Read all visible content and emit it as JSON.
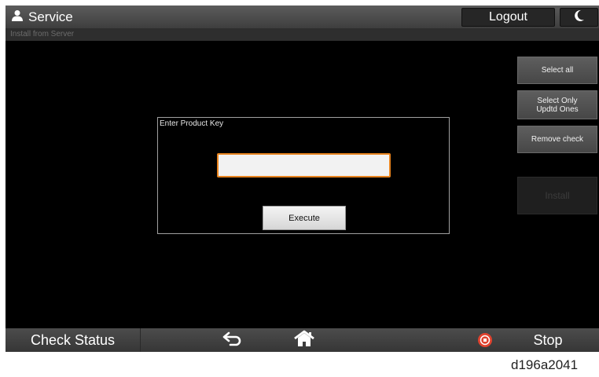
{
  "header": {
    "title": "Service",
    "logout_label": "Logout",
    "user_icon": "user-icon",
    "moon_icon": "moon-icon"
  },
  "subheader": {
    "text": "Install from Server"
  },
  "side_buttons": {
    "select_all": "Select all",
    "select_only_line1": "Select Only",
    "select_only_line2": "Updtd Ones",
    "remove_check": "Remove check",
    "install": "Install"
  },
  "dialog": {
    "title": "Enter Product Key",
    "input_value": "",
    "execute_label": "Execute"
  },
  "bottom_bar": {
    "check_status": "Check Status",
    "stop_label": "Stop",
    "back_icon": "back-arrow-icon",
    "home_icon": "home-icon",
    "stop_icon": "stop-icon"
  },
  "colors": {
    "accent_orange": "#e7831e",
    "stop_red": "#e0422e",
    "screen_bg": "#000000"
  },
  "figure_code": "d196a2041"
}
